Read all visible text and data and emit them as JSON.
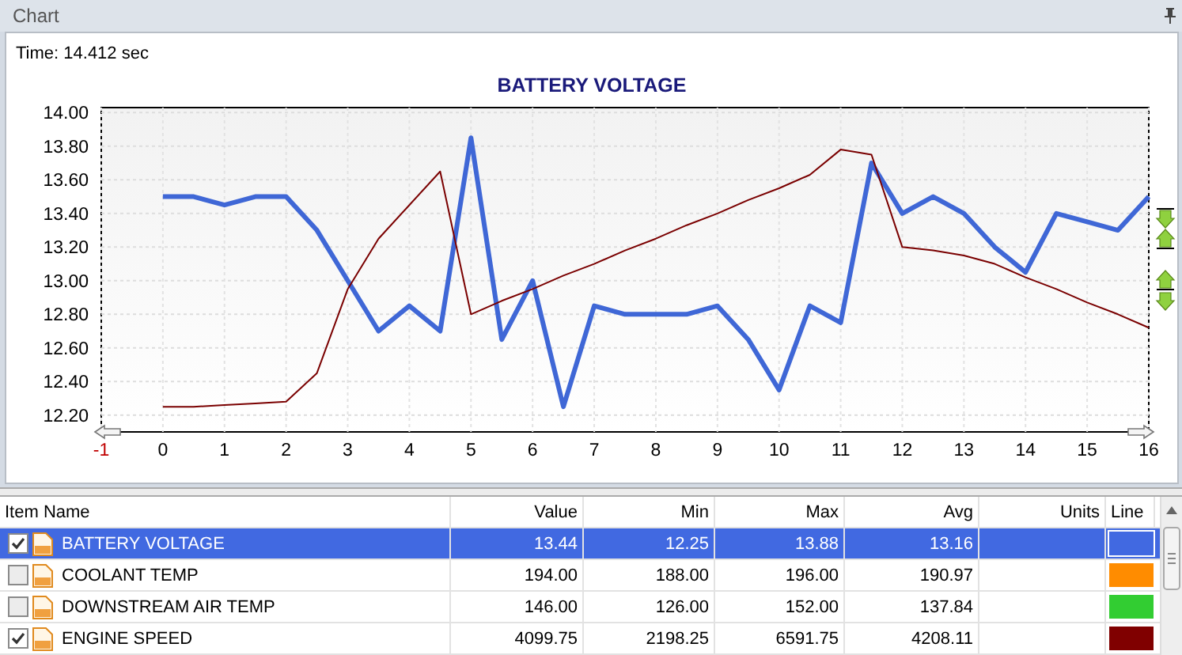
{
  "panel": {
    "title": "Chart",
    "time": "Time: 14.412 sec"
  },
  "chart": {
    "chart_data": {
      "type": "line",
      "title": "BATTERY VOLTAGE",
      "grid": true,
      "x": [
        0,
        0.5,
        1,
        1.5,
        2,
        2.5,
        3,
        3.5,
        4,
        4.5,
        5,
        5.5,
        6,
        6.5,
        7,
        7.5,
        8,
        8.5,
        9,
        9.5,
        10,
        10.5,
        11,
        11.5,
        12,
        12.5,
        13,
        13.5,
        14,
        14.5,
        15,
        15.5,
        16
      ],
      "series": [
        {
          "color": "#3f67d6",
          "values": [
            13.5,
            13.5,
            13.45,
            13.5,
            13.5,
            13.3,
            13.0,
            12.7,
            12.85,
            12.7,
            13.85,
            12.65,
            13.0,
            12.25,
            12.85,
            12.8,
            12.8,
            12.8,
            12.85,
            12.65,
            12.35,
            12.85,
            12.75,
            13.7,
            13.4,
            13.5,
            13.4,
            13.2,
            13.05,
            13.4,
            13.35,
            13.3,
            13.5
          ]
        },
        {
          "color": "#7a0000",
          "values": [
            12.25,
            12.25,
            12.26,
            12.27,
            12.28,
            12.45,
            12.95,
            13.25,
            13.45,
            13.65,
            12.8,
            12.88,
            12.95,
            13.03,
            13.1,
            13.18,
            13.25,
            13.33,
            13.4,
            13.48,
            13.55,
            13.63,
            13.78,
            13.75,
            13.2,
            13.18,
            13.15,
            13.1,
            13.02,
            12.95,
            12.87,
            12.8,
            12.72
          ]
        }
      ],
      "xlim": [
        -1,
        16
      ],
      "ylim": [
        12.1,
        14.03
      ],
      "xticks": [
        -1,
        0,
        1,
        2,
        3,
        4,
        5,
        6,
        7,
        8,
        9,
        10,
        11,
        12,
        13,
        14,
        15,
        16
      ],
      "yticks": [
        {
          "value": 12.2,
          "label": "12.20"
        },
        {
          "value": 12.4,
          "label": "12.40"
        },
        {
          "value": 12.6,
          "label": "12.60"
        },
        {
          "value": 12.8,
          "label": "12.80"
        },
        {
          "value": 13.0,
          "label": "13.00"
        },
        {
          "value": 13.2,
          "label": "13.20"
        },
        {
          "value": 13.4,
          "label": "13.40"
        },
        {
          "value": 13.6,
          "label": "13.60"
        },
        {
          "value": 13.8,
          "label": "13.80"
        },
        {
          "value": 14.0,
          "label": "14.00"
        }
      ]
    }
  },
  "table": {
    "columns": [
      "Item Name",
      "Value",
      "Min",
      "Max",
      "Avg",
      "Units",
      "Line"
    ],
    "rows": [
      {
        "name": "BATTERY VOLTAGE",
        "value": "13.44",
        "min": "12.25",
        "max": "13.88",
        "avg": "13.16",
        "checked": true,
        "selected": true,
        "color": "#4169e1"
      },
      {
        "name": "COOLANT TEMP",
        "value": "194.00",
        "min": "188.00",
        "max": "196.00",
        "avg": "190.97",
        "checked": false,
        "selected": false,
        "color": "#ff8c00"
      },
      {
        "name": "DOWNSTREAM AIR TEMP",
        "value": "146.00",
        "min": "126.00",
        "max": "152.00",
        "avg": "137.84",
        "checked": false,
        "selected": false,
        "color": "#32cd32"
      },
      {
        "name": "ENGINE SPEED",
        "value": "4099.75",
        "min": "2198.25",
        "max": "6591.75",
        "avg": "4208.11",
        "checked": true,
        "selected": false,
        "color": "#800000"
      }
    ]
  }
}
